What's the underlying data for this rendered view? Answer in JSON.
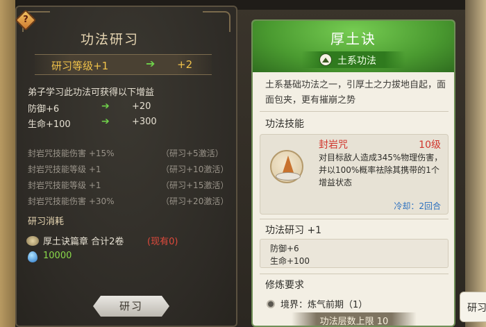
{
  "left": {
    "title": "功法研习",
    "level_label": "研习等级+1",
    "level_to": "+2",
    "gain_intro": "弟子学习此功法可获得以下增益",
    "gains": [
      {
        "stat": "防御+6",
        "to": "+20"
      },
      {
        "stat": "生命+100",
        "to": "+300"
      }
    ],
    "locked": [
      {
        "text": "封岩咒技能伤害 +15%",
        "cond": "（研习+5激活）"
      },
      {
        "text": "封岩咒技能等级 +1",
        "cond": "（研习+10激活）"
      },
      {
        "text": "封岩咒技能等级 +1",
        "cond": "（研习+15激活）"
      },
      {
        "text": "封岩咒技能伤害 +30%",
        "cond": "（研习+20激活）"
      }
    ],
    "cost_title": "研习消耗",
    "cost_item": "厚土诀篇章  合计2卷",
    "cost_have": "(现有0)",
    "cost_currency": "10000",
    "button": "研习"
  },
  "right": {
    "title": "厚土诀",
    "type": "土系功法",
    "desc": "土系基础功法之一，引厚土之力拔地自起，面面包夹，更有摧崩之势",
    "skill_section": "功法技能",
    "skill": {
      "name": "封岩咒",
      "level": "10级",
      "desc": "对目标敌人造成345%物理伤害，并以100%概率祛除其携带的1个增益状态",
      "cooldown": "冷却：2回合"
    },
    "study_section": "功法研习 +1",
    "study_stats": [
      "防御+6",
      "生命+100"
    ],
    "req_section": "修炼要求",
    "req": "境界：炼气前期（1）",
    "cap": "功法层数上限 10"
  },
  "side_tab": "研习"
}
